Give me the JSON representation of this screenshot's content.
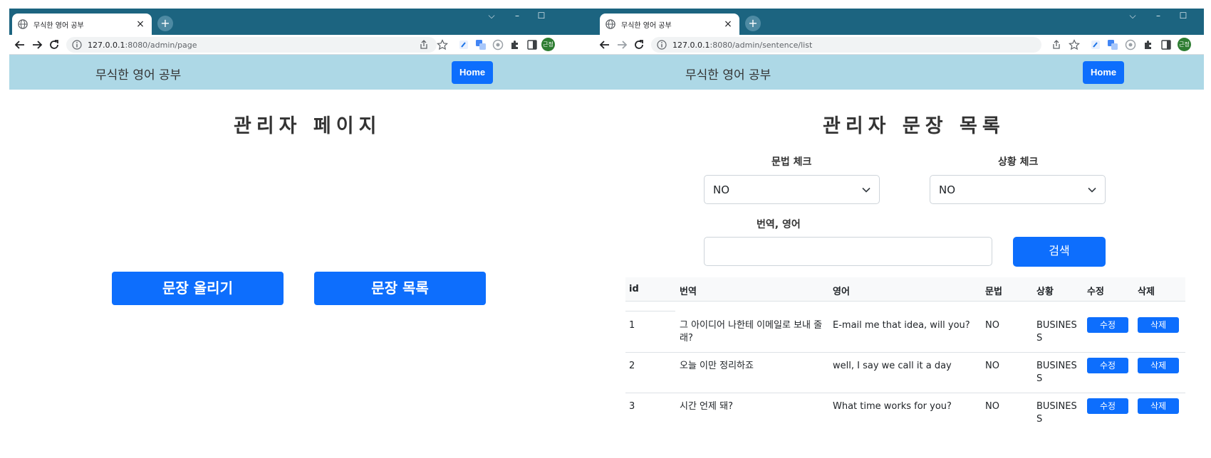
{
  "left": {
    "tab": {
      "title": "무식한 영어 공부",
      "close": "×"
    },
    "url": {
      "host": "127.0.0.1",
      "path": ":8080/admin/page"
    },
    "navbar": {
      "brand": "무식한 영어 공부",
      "home": "Home"
    },
    "main": {
      "title": "관리자 페이지",
      "upload_button": "문장 올리기",
      "list_button": "문장 목록"
    }
  },
  "right": {
    "tab": {
      "title": "무식한 영어 공부",
      "close": "×"
    },
    "url": {
      "host": "127.0.0.1",
      "path": ":8080/admin/sentence/list"
    },
    "navbar": {
      "brand": "무식한 영어 공부",
      "home": "Home"
    },
    "profile_label": "근정",
    "main": {
      "title": "관리자 문장 목록",
      "grammar_label": "문법 체크",
      "grammar_value": "NO",
      "situation_label": "상황 체크",
      "situation_value": "NO",
      "search_label": "번역, 영어",
      "search_value": "",
      "search_button": "검색"
    },
    "table": {
      "headers": [
        "id",
        "번역",
        "영어",
        "문법",
        "상황",
        "수정",
        "삭제"
      ],
      "rows": [
        {
          "id": "1",
          "translation": "그 아이디어 나한테 이메일로 보내 줄래?",
          "english": "E-mail me that idea, will you?",
          "grammar": "NO",
          "situation": "BUSINESS",
          "edit": "수정",
          "delete": "삭제"
        },
        {
          "id": "2",
          "translation": "오늘 이만 정리하죠",
          "english": "well, I say we call it a day",
          "grammar": "NO",
          "situation": "BUSINESS",
          "edit": "수정",
          "delete": "삭제"
        },
        {
          "id": "3",
          "translation": "시간 언제 돼?",
          "english": "What time works for you?",
          "grammar": "NO",
          "situation": "BUSINESS",
          "edit": "수정",
          "delete": "삭제"
        }
      ]
    }
  }
}
